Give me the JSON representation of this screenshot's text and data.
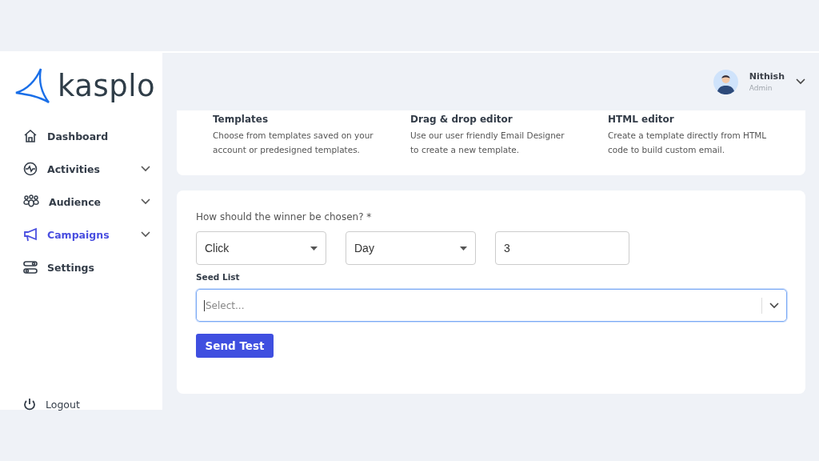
{
  "logo": {
    "text": "kasplo"
  },
  "sidebar": {
    "items": [
      {
        "label": "Dashboard",
        "selected": false,
        "has_submenu": false
      },
      {
        "label": "Activities",
        "selected": false,
        "has_submenu": true
      },
      {
        "label": "Audience",
        "selected": false,
        "has_submenu": true
      },
      {
        "label": "Campaigns",
        "selected": true,
        "has_submenu": true
      },
      {
        "label": "Settings",
        "selected": false,
        "has_submenu": false
      }
    ],
    "logout": "Logout"
  },
  "user": {
    "name": "Nithish",
    "role": "Admin"
  },
  "features": [
    {
      "title": "Templates",
      "description": "Choose from templates saved on your account or predesigned templates."
    },
    {
      "title": "Drag & drop editor",
      "description": "Use our user friendly Email Designer to create a new template."
    },
    {
      "title": "HTML editor",
      "description": "Create a template directly from HTML code to build custom email."
    }
  ],
  "form": {
    "question": "How should the winner be chosen? *",
    "fields": [
      {
        "kind": "select",
        "value": "Click"
      },
      {
        "kind": "select",
        "value": "Day"
      },
      {
        "kind": "input",
        "value": "3"
      }
    ],
    "seed_list": {
      "label": "Seed List",
      "placeholder": "Select...",
      "focused": true
    },
    "button": "Send Test"
  }
}
